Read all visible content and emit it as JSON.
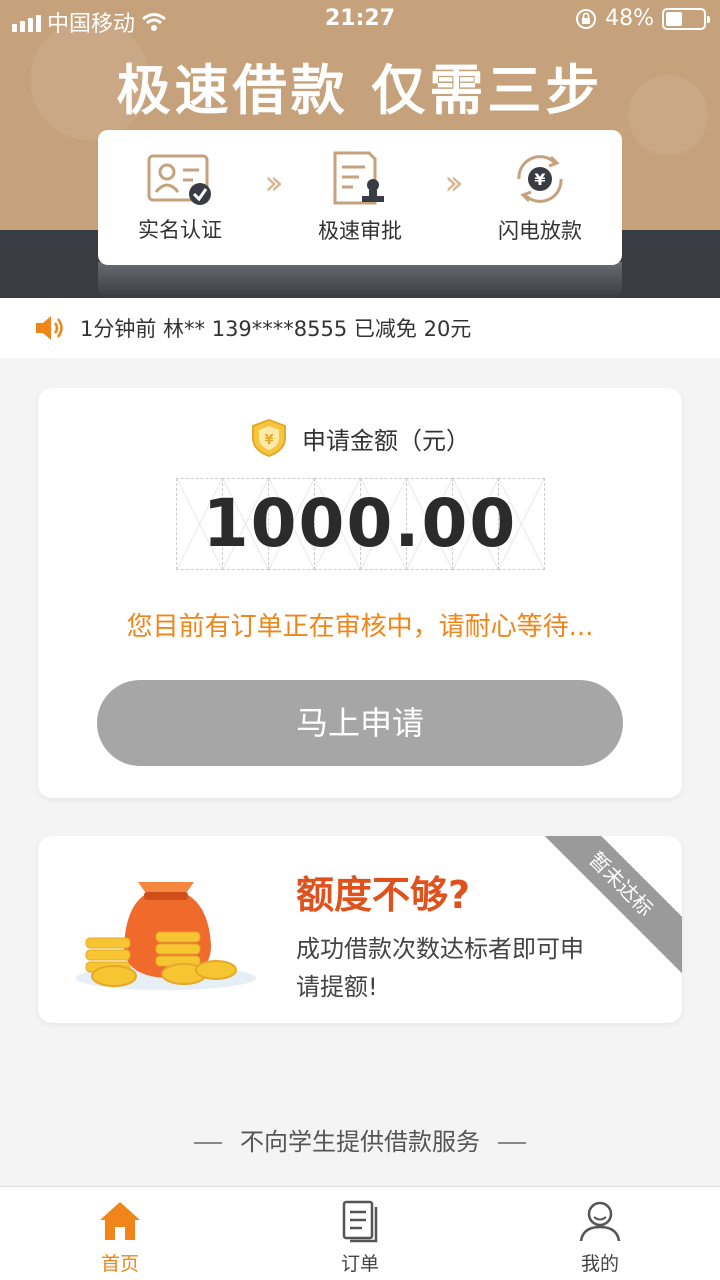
{
  "status_bar": {
    "carrier": "中国移动",
    "time": "21:27",
    "battery": "48%"
  },
  "hero": {
    "title": "极速借款 仅需三步"
  },
  "steps": [
    {
      "label": "实名认证",
      "icon": "id-card-check-icon"
    },
    {
      "label": "极速审批",
      "icon": "approval-document-icon"
    },
    {
      "label": "闪电放款",
      "icon": "yen-refresh-icon"
    }
  ],
  "notice": {
    "text": "1分钟前 林** 139****8555 已减免 20元",
    "icon": "speaker-icon"
  },
  "apply": {
    "heading": "申请金额（元）",
    "amount": "1000.00",
    "review_message": "您目前有订单正在审核中，请耐心等待...",
    "button_label": "马上申请"
  },
  "limit": {
    "title": "额度不够?",
    "description": "成功借款次数达标者即可申请提额!",
    "ribbon": "暂未达标"
  },
  "footer_note": "不向学生提供借款服务",
  "tabs": [
    {
      "label": "首页",
      "icon": "home-icon",
      "active": true
    },
    {
      "label": "订单",
      "icon": "order-list-icon",
      "active": false
    },
    {
      "label": "我的",
      "icon": "profile-icon",
      "active": false
    }
  ],
  "colors": {
    "brand": "#c6a27c",
    "accent": "#f08519",
    "dark": "#3a3c44",
    "limit_title": "#e0521d"
  }
}
